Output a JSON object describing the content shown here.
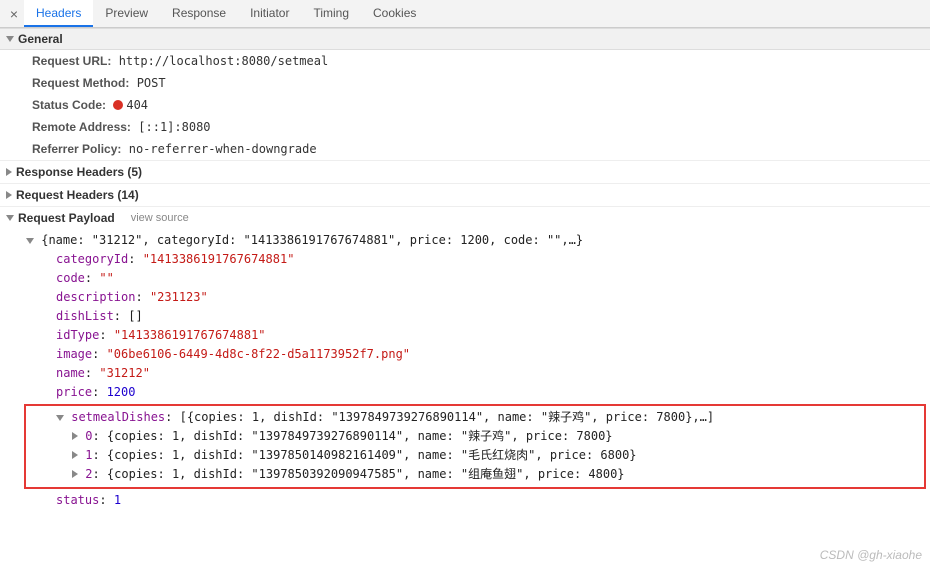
{
  "tabs": {
    "close": "×",
    "items": [
      {
        "label": "Headers",
        "active": true
      },
      {
        "label": "Preview",
        "active": false
      },
      {
        "label": "Response",
        "active": false
      },
      {
        "label": "Initiator",
        "active": false
      },
      {
        "label": "Timing",
        "active": false
      },
      {
        "label": "Cookies",
        "active": false
      }
    ]
  },
  "general": {
    "title": "General",
    "request_url_label": "Request URL:",
    "request_url": "http://localhost:8080/setmeal",
    "request_method_label": "Request Method:",
    "request_method": "POST",
    "status_code_label": "Status Code:",
    "status_code": "404",
    "remote_address_label": "Remote Address:",
    "remote_address": "[::1]:8080",
    "referrer_policy_label": "Referrer Policy:",
    "referrer_policy": "no-referrer-when-downgrade"
  },
  "response_headers": {
    "title": "Response Headers (5)"
  },
  "request_headers": {
    "title": "Request Headers (14)"
  },
  "payload": {
    "title": "Request Payload",
    "view_source": "view source",
    "summary": "{name: \"31212\", categoryId: \"1413386191767674881\", price: 1200, code: \"\",…}",
    "fields": {
      "categoryId": "\"1413386191767674881\"",
      "code": "\"\"",
      "description": "\"231123\"",
      "dishList": "[]",
      "idType": "\"1413386191767674881\"",
      "image": "\"06be6106-6449-4d8c-8f22-d5a1173952f7.png\"",
      "name": "\"31212\"",
      "price": "1200",
      "status": "1"
    },
    "setmealDishes": {
      "key": "setmealDishes",
      "summary": "[{copies: 1, dishId: \"1397849739276890114\", name: \"辣子鸡\", price: 7800},…]",
      "items": [
        {
          "idx": "0",
          "body": "{copies: 1, dishId: \"1397849739276890114\", name: \"辣子鸡\", price: 7800}"
        },
        {
          "idx": "1",
          "body": "{copies: 1, dishId: \"1397850140982161409\", name: \"毛氏红烧肉\", price: 6800}"
        },
        {
          "idx": "2",
          "body": "{copies: 1, dishId: \"1397850392090947585\", name: \"组庵鱼翅\", price: 4800}"
        }
      ]
    }
  },
  "watermark": "CSDN @gh-xiaohe"
}
